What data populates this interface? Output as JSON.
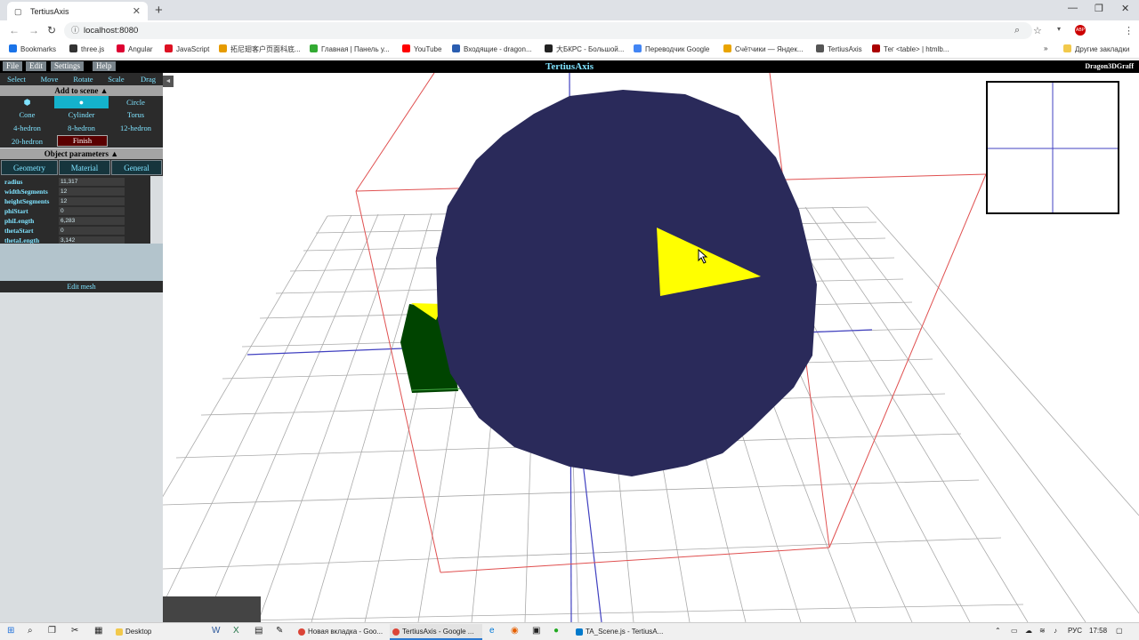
{
  "browser": {
    "tab_title": "TertiusAxis",
    "new_tab": "+",
    "url": "localhost:8080",
    "icons": [
      "back-icon",
      "forward-icon",
      "reload-icon",
      "info-icon",
      "zoom-icon",
      "star-icon",
      "abp-icon",
      "menu-icon"
    ]
  },
  "bookmarks": [
    {
      "label": "Bookmarks",
      "color": "#1a73e8"
    },
    {
      "label": "three.js",
      "color": "#333"
    },
    {
      "label": "Angular",
      "color": "#dd0031"
    },
    {
      "label": "JavaScript",
      "color": "#d12"
    },
    {
      "label": "拓尼翅客户页面科底...",
      "color": "#e69b00"
    },
    {
      "label": "Главная | Панель у...",
      "color": "#3a3"
    },
    {
      "label": "YouTube",
      "color": "#f00"
    },
    {
      "label": "Входящие - dragon...",
      "color": "#2a5db0"
    },
    {
      "label": "大БКРС - Большой...",
      "color": "#222"
    },
    {
      "label": "Переводчик Google",
      "color": "#4285f4"
    },
    {
      "label": "Счётчики — Яндек...",
      "color": "#e9a400"
    },
    {
      "label": "TertiusAxis",
      "color": "#555"
    },
    {
      "label": "Тег <table> | htmlb...",
      "color": "#a00"
    },
    {
      "label": "»",
      "color": ""
    },
    {
      "label": "Другие закладки",
      "color": "#f2c94c"
    }
  ],
  "app": {
    "menu": [
      "File",
      "Edit",
      "Settings",
      "Help"
    ],
    "title": "TertiusAxis",
    "brand": "Dragon3DGraff",
    "tools": [
      "Select",
      "Move",
      "Rotate",
      "Scale",
      "Drag"
    ],
    "add_header": "Add to scene ▲",
    "shapes": [
      "",
      "",
      "Circle",
      "Cone",
      "Cylinder",
      "Torus",
      "4-hedron",
      "8-hedron",
      "12-hedron",
      "20-hedron"
    ],
    "finish": "Finish",
    "params_header": "Object parameters ▲",
    "param_tabs": [
      "Geometry",
      "Material",
      "General"
    ],
    "params": [
      {
        "label": "radius",
        "value": "11,317"
      },
      {
        "label": "widthSegments",
        "value": "12"
      },
      {
        "label": "heightSegments",
        "value": "12"
      },
      {
        "label": "phiStart",
        "value": "0"
      },
      {
        "label": "phiLength",
        "value": "6,283"
      },
      {
        "label": "thetaStart",
        "value": "0"
      },
      {
        "label": "thetaLength",
        "value": "3,142"
      }
    ],
    "edit_mesh": "Edit mesh",
    "collapse": "◄"
  },
  "colors": {
    "sphere": "#2a2a5a",
    "triangle": "#ffff00",
    "box_green": "#004400",
    "grid": "#999999",
    "bbox": "#e05050",
    "axis_blue": "#4040c0"
  },
  "taskbar": {
    "items": [
      "Desktop",
      "Новая вкладка - Goo...",
      "TertiusAxis - Google ...",
      "TA_Scene.js - TertiusA..."
    ],
    "lang": "РУС",
    "time": "17:58"
  }
}
